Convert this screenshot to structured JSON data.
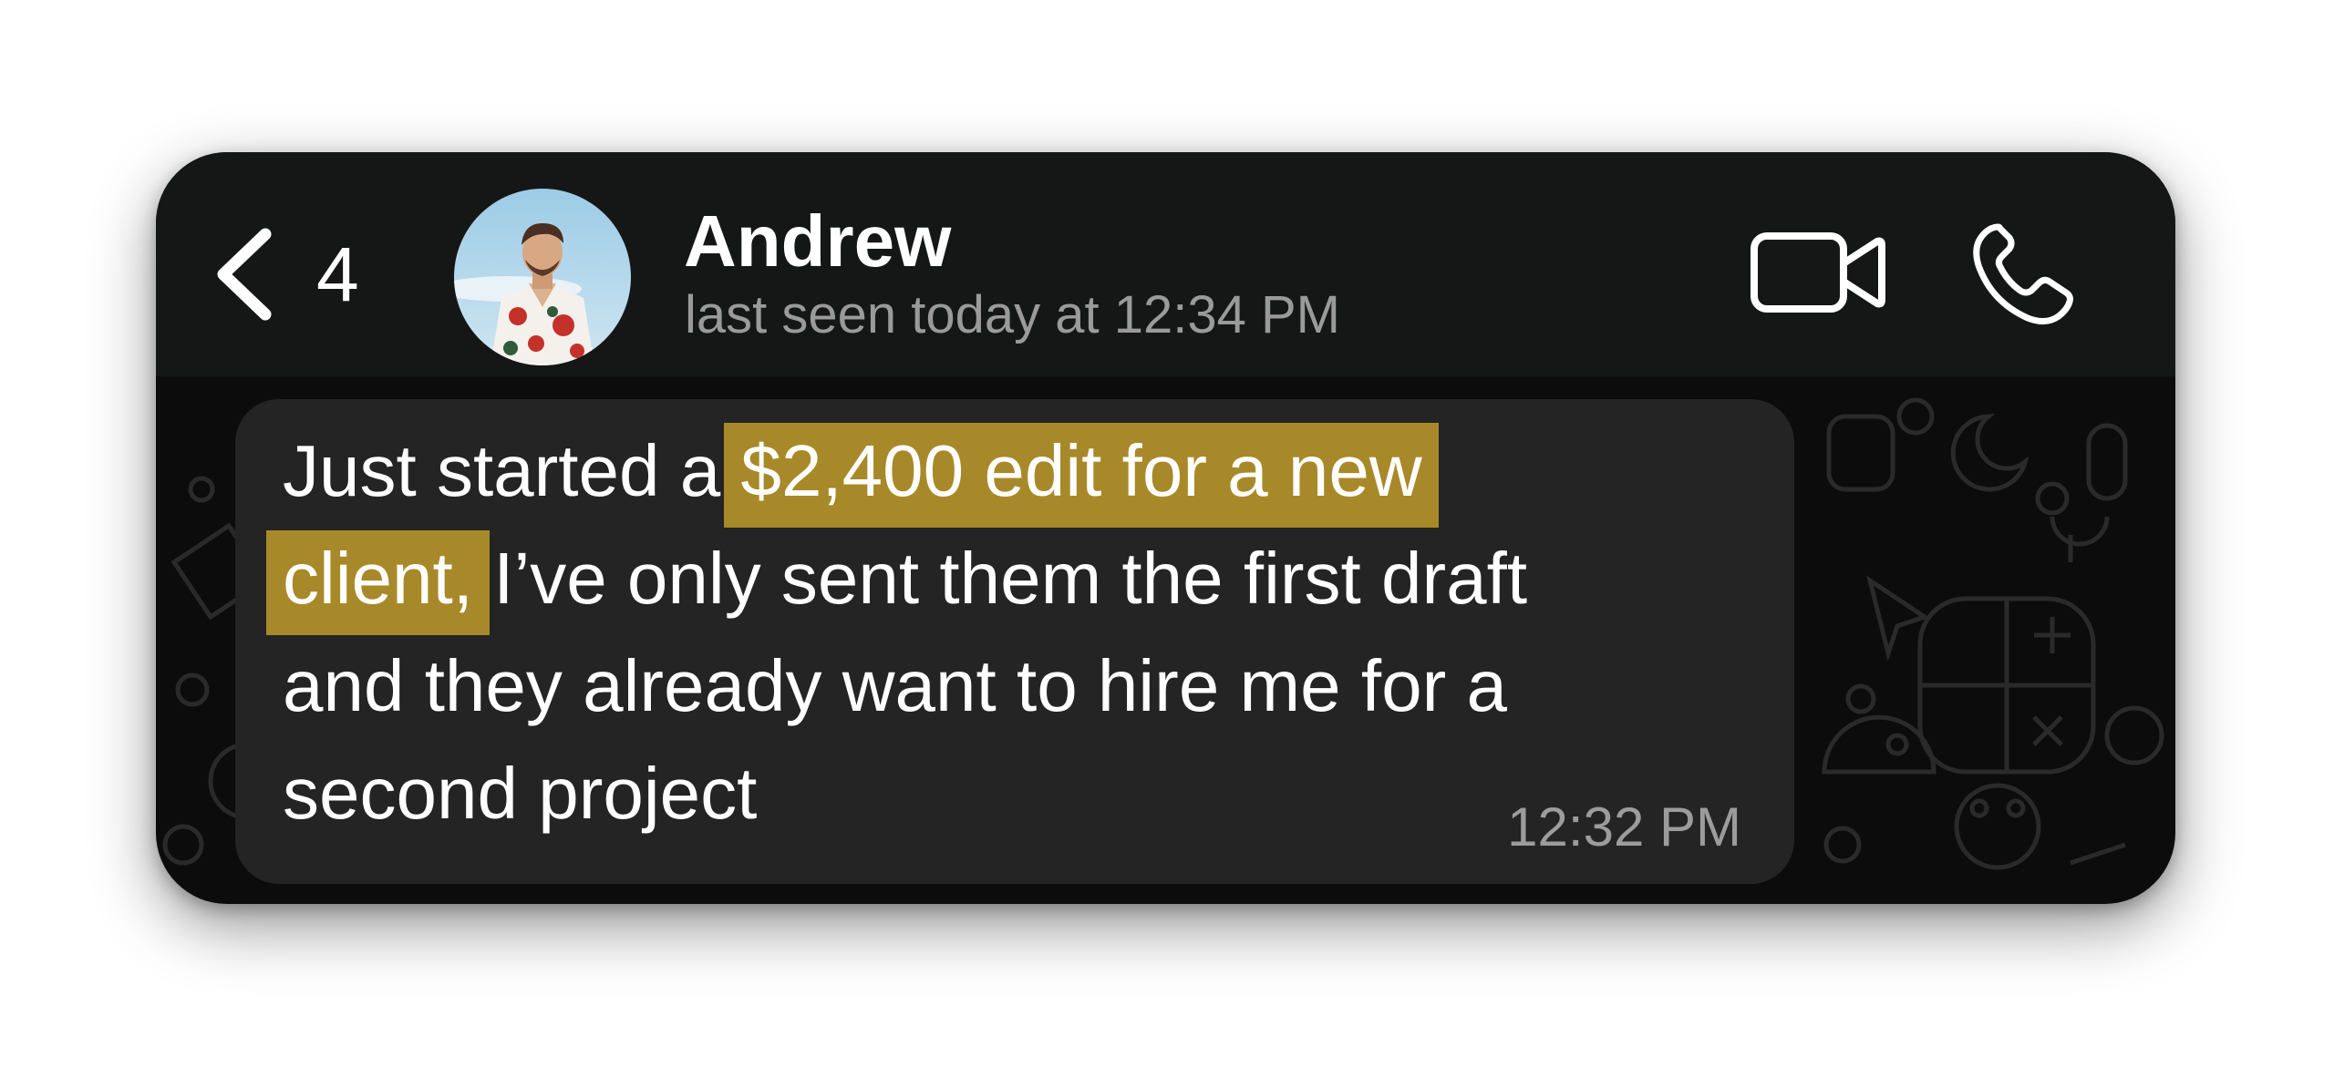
{
  "header": {
    "back_count": "4",
    "contact_name": "Andrew",
    "last_seen": "last seen today at 12:34 PM"
  },
  "message": {
    "line1_plain": "Just started a ",
    "line1_highlight": "$2,400 edit for a new",
    "line2_highlight": "client,",
    "line2_plain": " I’ve only sent them the first draft",
    "line3": "and they already want to hire me for a",
    "line4": "second project",
    "time": "12:32 PM"
  },
  "icons": {
    "back": "chevron-left-icon",
    "video": "video-camera-icon",
    "call": "phone-icon"
  },
  "colors": {
    "header_bg": "#151716",
    "chat_bg": "#0c0c0c",
    "bubble_bg": "#232423",
    "highlight": "#a8892a",
    "text_primary": "#ffffff",
    "text_secondary": "#9a9a9a"
  }
}
